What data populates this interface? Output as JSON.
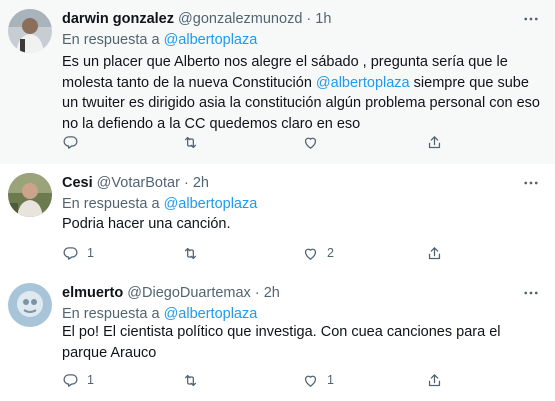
{
  "tweets": [
    {
      "name": "darwin gonzalez",
      "handle": "@gonzalezmunozd",
      "dot": "·",
      "time": "1h",
      "reply_prefix": "En respuesta a",
      "reply_to": "@albertoplaza",
      "text_before": "Es un placer que Alberto nos alegre el sábado , pregunta sería que le molesta tanto de la nueva Constitución ",
      "text_mention": "@albertoplaza",
      "text_after": " siempre que sube un twuiter es dirigido asia la constitución algún problema personal con eso no la defiendo a la CC quedemos claro en eso",
      "reply_count": "",
      "retweet_count": "",
      "like_count": ""
    },
    {
      "name": "Cesi",
      "handle": "@VotarBotar",
      "dot": "·",
      "time": "2h",
      "reply_prefix": "En respuesta a",
      "reply_to": "@albertoplaza",
      "text": "Podria hacer una canción.",
      "reply_count": "1",
      "retweet_count": "",
      "like_count": "2"
    },
    {
      "name": "elmuerto",
      "handle": "@DiegoDuartemax",
      "dot": "·",
      "time": "2h",
      "reply_prefix": "En respuesta a",
      "reply_to": "@albertoplaza",
      "text": "El po! El cientista político que investiga. Con cuea canciones para el parque Arauco",
      "reply_count": "1",
      "retweet_count": "",
      "like_count": "1"
    }
  ],
  "icons": {
    "reply": "reply-icon",
    "retweet": "retweet-icon",
    "like": "like-icon",
    "share": "share-icon",
    "more": "more-icon"
  },
  "colors": {
    "link": "#1d9bf0",
    "muted": "#536471",
    "text": "#0f1419",
    "highlight_bg": "#f7f9f9"
  }
}
